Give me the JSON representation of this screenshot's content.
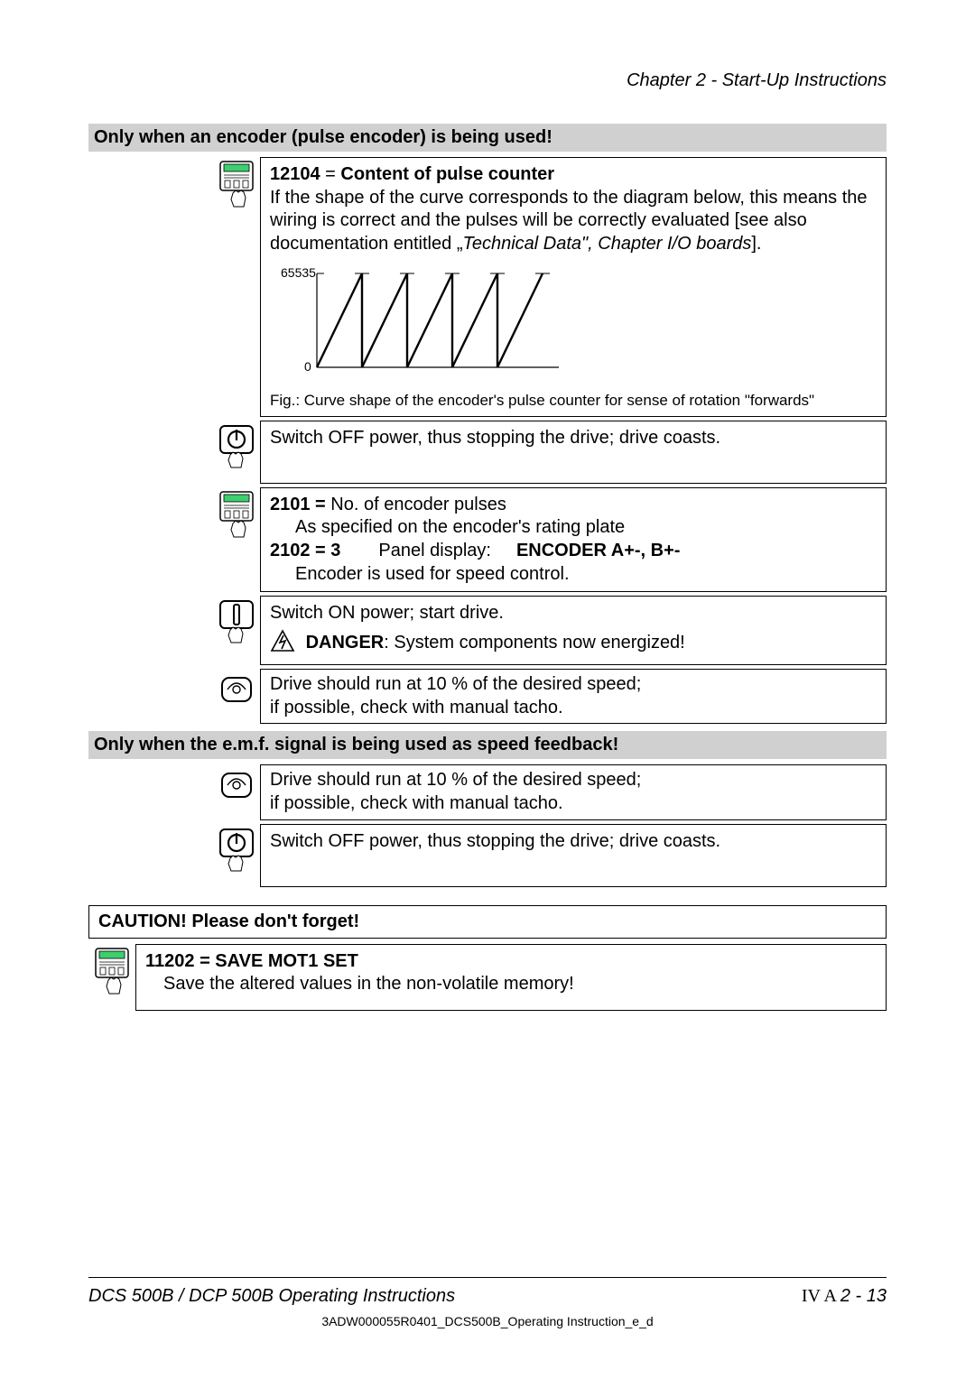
{
  "header": {
    "chapter": "Chapter 2 - Start-Up Instructions"
  },
  "sections": {
    "encoder_header": "Only when an encoder (pulse encoder) is being used!",
    "emf_header": "Only when the e.m.f. signal is being used as speed feedback!"
  },
  "box1": {
    "param": "12104",
    "eq": " = ",
    "title": "Content of pulse counter",
    "text": "If the shape of the curve corresponds to the diagram below, this means the wiring is correct and the pulses will be correctly evaluated [see also documentation entitled ",
    "doc_quote_open": "„",
    "doc_title": "Technical Data\", Chapter I/O boards",
    "doc_close": "].",
    "caption": "Fig.: Curve shape of the encoder's pulse counter for sense of rotation \"forwards\""
  },
  "box2": {
    "text": "Switch OFF power, thus stopping the drive; drive coasts."
  },
  "box3": {
    "p2101": "2101 = ",
    "p2101_desc": "No. of encoder pulses",
    "p2101_sub": "As specified on the encoder's rating plate",
    "p2102": "2102 = 3",
    "panel_label": "Panel display:",
    "panel_value": "ENCODER A+-, B+-",
    "p2102_sub": "Encoder is used for speed control."
  },
  "box4": {
    "text": "Switch ON power; start drive.",
    "danger_label": "DANGER",
    "danger_text": ": System components now energized!"
  },
  "box5": {
    "line1": "Drive should run at 10 % of the desired speed;",
    "line2": "if possible, check with manual tacho."
  },
  "box6": {
    "line1": "Drive should run at 10 % of the desired speed;",
    "line2": "if possible, check with manual tacho."
  },
  "box7": {
    "text": "Switch OFF power, thus stopping the drive; drive coasts."
  },
  "caution": {
    "label": "CAUTION!",
    "gap": "   ",
    "text": "Please don't forget!"
  },
  "save": {
    "param": "11202 = SAVE MOT1 SET",
    "text": "Save the altered values in the non-volatile memory!"
  },
  "footer": {
    "left": "DCS 500B / DCP 500B Operating Instructions",
    "right_prefix": "IV A ",
    "right_page": "2 - 13",
    "docid": "3ADW000055R0401_DCS500B_Operating Instruction_e_d"
  },
  "chart_data": {
    "type": "line",
    "title": "",
    "xlabel": "",
    "ylabel": "",
    "ytick_labels": [
      "0",
      "65535"
    ],
    "ylim": [
      0,
      65535
    ],
    "description": "Repeating sawtooth ramp from 0 to 65535",
    "series": [
      {
        "name": "pulse-counter",
        "x": [
          0,
          1,
          1,
          2,
          2,
          3,
          3,
          4,
          4,
          5
        ],
        "y": [
          0,
          65535,
          0,
          65535,
          0,
          65535,
          0,
          65535,
          0,
          65535
        ]
      }
    ]
  }
}
